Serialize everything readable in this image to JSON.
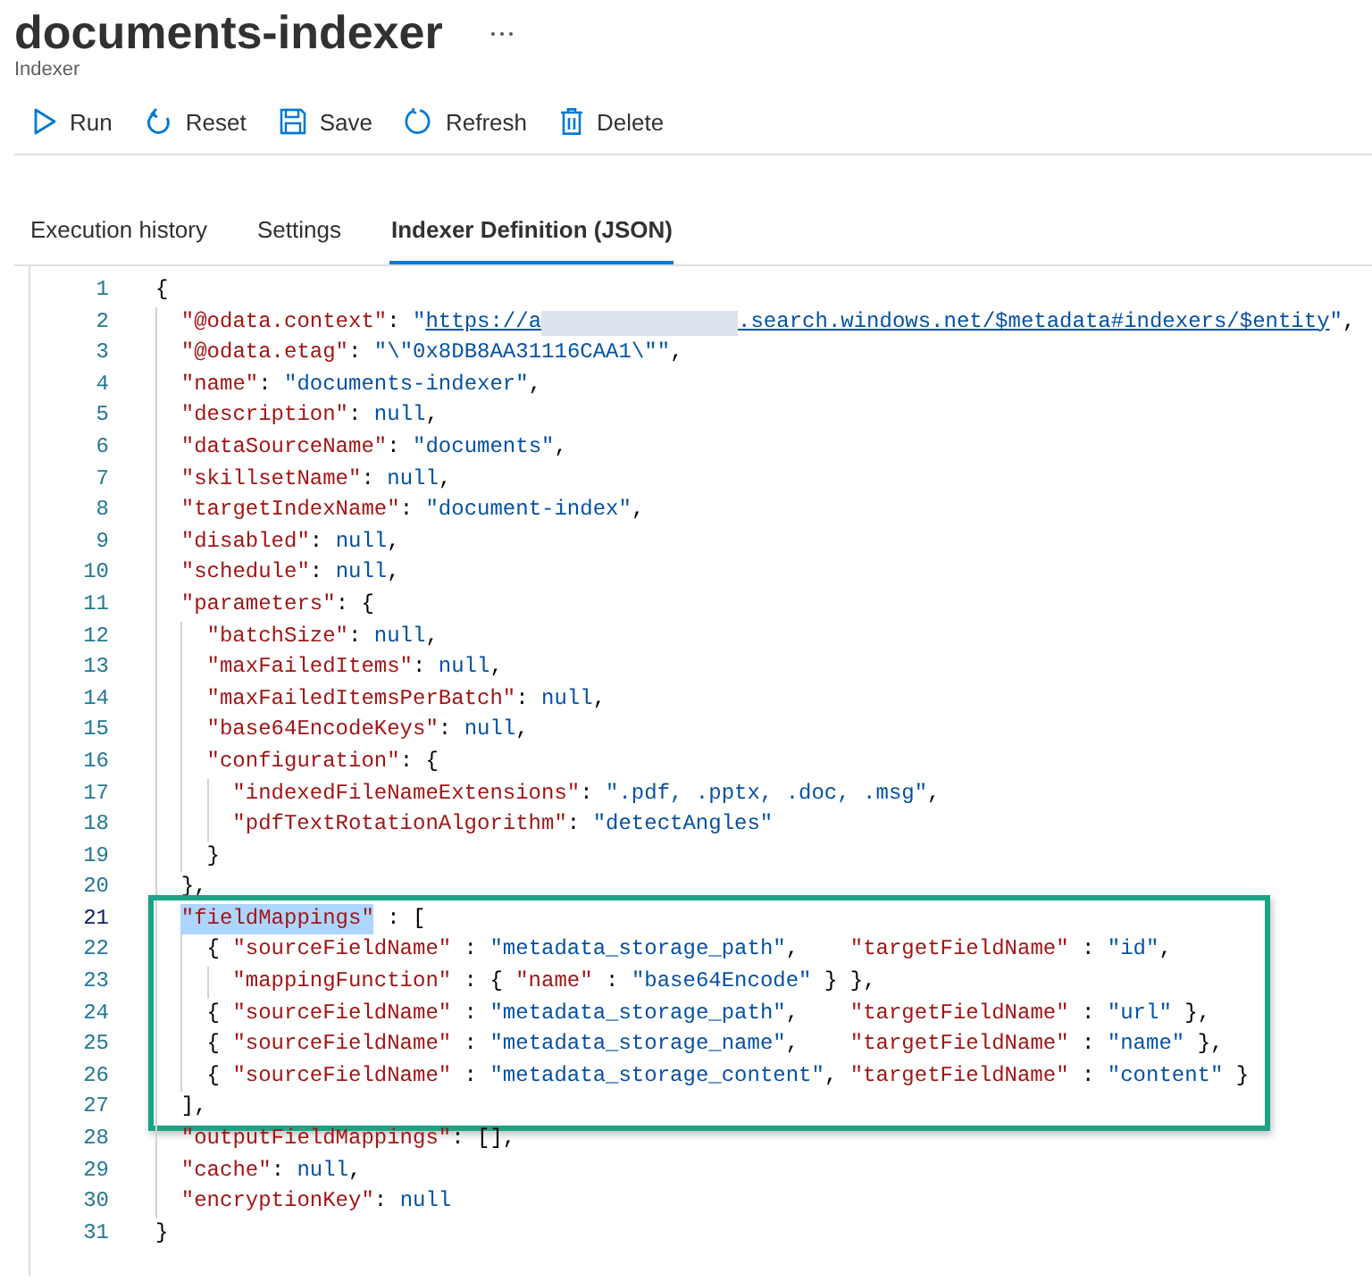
{
  "header": {
    "title": "documents-indexer",
    "subtitle": "Indexer"
  },
  "toolbar": [
    {
      "kind": "run",
      "label": "Run"
    },
    {
      "kind": "reset",
      "label": "Reset"
    },
    {
      "kind": "save",
      "label": "Save"
    },
    {
      "kind": "refresh",
      "label": "Refresh"
    },
    {
      "kind": "delete",
      "label": "Delete"
    }
  ],
  "tabs": [
    {
      "label": "Execution history",
      "selected": false
    },
    {
      "label": "Settings",
      "selected": false
    },
    {
      "label": "Indexer Definition (JSON)",
      "selected": true
    }
  ],
  "editor": {
    "lines": [
      {
        "number": "1",
        "current": false,
        "boxed": false,
        "tokens": [
          {
            "kind": "p",
            "text": "{"
          }
        ],
        "children": [
          {
            "number": "2",
            "current": false,
            "boxed": false,
            "tokens": [
              {
                "kind": "k",
                "text": "\"@odata.context\""
              },
              {
                "kind": "p",
                "text": ": "
              },
              {
                "kind": "s",
                "text": "\""
              },
              {
                "kind": "link",
                "text": "https://a"
              },
              {
                "kind": "redacted"
              },
              {
                "kind": "link",
                "text": ".search.windows.net/$metadata#indexers/$entity"
              },
              {
                "kind": "s",
                "text": "\""
              },
              {
                "kind": "p",
                "text": ","
              }
            ]
          },
          {
            "number": "3",
            "current": false,
            "boxed": false,
            "tokens": [
              {
                "kind": "k",
                "text": "\"@odata.etag\""
              },
              {
                "kind": "p",
                "text": ": "
              },
              {
                "kind": "s",
                "text": "\"\\\"0x8DB8AA31116CAA1\\\"\""
              },
              {
                "kind": "p",
                "text": ","
              }
            ]
          },
          {
            "number": "4",
            "current": false,
            "boxed": false,
            "tokens": [
              {
                "kind": "k",
                "text": "\"name\""
              },
              {
                "kind": "p",
                "text": ": "
              },
              {
                "kind": "s",
                "text": "\"documents-indexer\""
              },
              {
                "kind": "p",
                "text": ","
              }
            ]
          },
          {
            "number": "5",
            "current": false,
            "boxed": false,
            "tokens": [
              {
                "kind": "k",
                "text": "\"description\""
              },
              {
                "kind": "p",
                "text": ": "
              },
              {
                "kind": "n",
                "text": "null"
              },
              {
                "kind": "p",
                "text": ","
              }
            ]
          },
          {
            "number": "6",
            "current": false,
            "boxed": false,
            "tokens": [
              {
                "kind": "k",
                "text": "\"dataSourceName\""
              },
              {
                "kind": "p",
                "text": ": "
              },
              {
                "kind": "s",
                "text": "\"documents\""
              },
              {
                "kind": "p",
                "text": ","
              }
            ]
          },
          {
            "number": "7",
            "current": false,
            "boxed": false,
            "tokens": [
              {
                "kind": "k",
                "text": "\"skillsetName\""
              },
              {
                "kind": "p",
                "text": ": "
              },
              {
                "kind": "n",
                "text": "null"
              },
              {
                "kind": "p",
                "text": ","
              }
            ]
          },
          {
            "number": "8",
            "current": false,
            "boxed": false,
            "tokens": [
              {
                "kind": "k",
                "text": "\"targetIndexName\""
              },
              {
                "kind": "p",
                "text": ": "
              },
              {
                "kind": "s",
                "text": "\"document-index\""
              },
              {
                "kind": "p",
                "text": ","
              }
            ]
          },
          {
            "number": "9",
            "current": false,
            "boxed": false,
            "tokens": [
              {
                "kind": "k",
                "text": "\"disabled\""
              },
              {
                "kind": "p",
                "text": ": "
              },
              {
                "kind": "n",
                "text": "null"
              },
              {
                "kind": "p",
                "text": ","
              }
            ]
          },
          {
            "number": "10",
            "current": false,
            "boxed": false,
            "tokens": [
              {
                "kind": "k",
                "text": "\"schedule\""
              },
              {
                "kind": "p",
                "text": ": "
              },
              {
                "kind": "n",
                "text": "null"
              },
              {
                "kind": "p",
                "text": ","
              }
            ]
          },
          {
            "number": "11",
            "current": false,
            "boxed": false,
            "tokens": [
              {
                "kind": "k",
                "text": "\"parameters\""
              },
              {
                "kind": "p",
                "text": ": {"
              }
            ],
            "children": [
              {
                "number": "12",
                "current": false,
                "boxed": false,
                "tokens": [
                  {
                    "kind": "k",
                    "text": "\"batchSize\""
                  },
                  {
                    "kind": "p",
                    "text": ": "
                  },
                  {
                    "kind": "n",
                    "text": "null"
                  },
                  {
                    "kind": "p",
                    "text": ","
                  }
                ]
              },
              {
                "number": "13",
                "current": false,
                "boxed": false,
                "tokens": [
                  {
                    "kind": "k",
                    "text": "\"maxFailedItems\""
                  },
                  {
                    "kind": "p",
                    "text": ": "
                  },
                  {
                    "kind": "n",
                    "text": "null"
                  },
                  {
                    "kind": "p",
                    "text": ","
                  }
                ]
              },
              {
                "number": "14",
                "current": false,
                "boxed": false,
                "tokens": [
                  {
                    "kind": "k",
                    "text": "\"maxFailedItemsPerBatch\""
                  },
                  {
                    "kind": "p",
                    "text": ": "
                  },
                  {
                    "kind": "n",
                    "text": "null"
                  },
                  {
                    "kind": "p",
                    "text": ","
                  }
                ]
              },
              {
                "number": "15",
                "current": false,
                "boxed": false,
                "tokens": [
                  {
                    "kind": "k",
                    "text": "\"base64EncodeKeys\""
                  },
                  {
                    "kind": "p",
                    "text": ": "
                  },
                  {
                    "kind": "n",
                    "text": "null"
                  },
                  {
                    "kind": "p",
                    "text": ","
                  }
                ]
              },
              {
                "number": "16",
                "current": false,
                "boxed": false,
                "tokens": [
                  {
                    "kind": "k",
                    "text": "\"configuration\""
                  },
                  {
                    "kind": "p",
                    "text": ": {"
                  }
                ],
                "children": [
                  {
                    "number": "17",
                    "current": false,
                    "boxed": false,
                    "tokens": [
                      {
                        "kind": "k",
                        "text": "\"indexedFileNameExtensions\""
                      },
                      {
                        "kind": "p",
                        "text": ": "
                      },
                      {
                        "kind": "s",
                        "text": "\".pdf, .pptx, .doc, .msg\""
                      },
                      {
                        "kind": "p",
                        "text": ","
                      }
                    ]
                  },
                  {
                    "number": "18",
                    "current": false,
                    "boxed": false,
                    "tokens": [
                      {
                        "kind": "k",
                        "text": "\"pdfTextRotationAlgorithm\""
                      },
                      {
                        "kind": "p",
                        "text": ": "
                      },
                      {
                        "kind": "s",
                        "text": "\"detectAngles\""
                      }
                    ]
                  }
                ],
                "end": {
                  "number": "19",
                  "current": false,
                  "tokens": [
                    {
                      "kind": "p",
                      "text": "}"
                    }
                  ]
                }
              }
            ],
            "end": {
              "number": "20",
              "current": false,
              "tokens": [
                {
                  "kind": "p",
                  "text": "},"
                }
              ]
            }
          },
          {
            "number": "21",
            "current": true,
            "boxed": true,
            "tokens": [
              {
                "kind": "selkey",
                "text": "\"fieldMappings\""
              },
              {
                "kind": "p",
                "text": " : ["
              }
            ],
            "children": [
              {
                "number": "22",
                "current": false,
                "boxed": false,
                "tokens": [
                  {
                    "kind": "p",
                    "text": "{ "
                  },
                  {
                    "kind": "k",
                    "text": "\"sourceFieldName\""
                  },
                  {
                    "kind": "p",
                    "text": " : "
                  },
                  {
                    "kind": "s",
                    "text": "\"metadata_storage_path\""
                  },
                  {
                    "kind": "p",
                    "text": ",    "
                  },
                  {
                    "kind": "k",
                    "text": "\"targetFieldName\""
                  },
                  {
                    "kind": "p",
                    "text": " : "
                  },
                  {
                    "kind": "s",
                    "text": "\"id\""
                  },
                  {
                    "kind": "p",
                    "text": ","
                  }
                ],
                "children": [
                  {
                    "number": "23",
                    "current": false,
                    "boxed": false,
                    "tokens": [
                      {
                        "kind": "k",
                        "text": "\"mappingFunction\""
                      },
                      {
                        "kind": "p",
                        "text": " : { "
                      },
                      {
                        "kind": "k",
                        "text": "\"name\""
                      },
                      {
                        "kind": "p",
                        "text": " : "
                      },
                      {
                        "kind": "s",
                        "text": "\"base64Encode\""
                      },
                      {
                        "kind": "p",
                        "text": " } },"
                      }
                    ]
                  }
                ]
              },
              {
                "number": "24",
                "current": false,
                "boxed": false,
                "tokens": [
                  {
                    "kind": "p",
                    "text": "{ "
                  },
                  {
                    "kind": "k",
                    "text": "\"sourceFieldName\""
                  },
                  {
                    "kind": "p",
                    "text": " : "
                  },
                  {
                    "kind": "s",
                    "text": "\"metadata_storage_path\""
                  },
                  {
                    "kind": "p",
                    "text": ",    "
                  },
                  {
                    "kind": "k",
                    "text": "\"targetFieldName\""
                  },
                  {
                    "kind": "p",
                    "text": " : "
                  },
                  {
                    "kind": "s",
                    "text": "\"url\""
                  },
                  {
                    "kind": "p",
                    "text": " },"
                  }
                ]
              },
              {
                "number": "25",
                "current": false,
                "boxed": false,
                "tokens": [
                  {
                    "kind": "p",
                    "text": "{ "
                  },
                  {
                    "kind": "k",
                    "text": "\"sourceFieldName\""
                  },
                  {
                    "kind": "p",
                    "text": " : "
                  },
                  {
                    "kind": "s",
                    "text": "\"metadata_storage_name\""
                  },
                  {
                    "kind": "p",
                    "text": ",    "
                  },
                  {
                    "kind": "k",
                    "text": "\"targetFieldName\""
                  },
                  {
                    "kind": "p",
                    "text": " : "
                  },
                  {
                    "kind": "s",
                    "text": "\"name\""
                  },
                  {
                    "kind": "p",
                    "text": " },"
                  }
                ]
              },
              {
                "number": "26",
                "current": false,
                "boxed": false,
                "tokens": [
                  {
                    "kind": "p",
                    "text": "{ "
                  },
                  {
                    "kind": "k",
                    "text": "\"sourceFieldName\""
                  },
                  {
                    "kind": "p",
                    "text": " : "
                  },
                  {
                    "kind": "s",
                    "text": "\"metadata_storage_content\""
                  },
                  {
                    "kind": "p",
                    "text": ", "
                  },
                  {
                    "kind": "k",
                    "text": "\"targetFieldName\""
                  },
                  {
                    "kind": "p",
                    "text": " : "
                  },
                  {
                    "kind": "s",
                    "text": "\"content\""
                  },
                  {
                    "kind": "p",
                    "text": " }"
                  }
                ]
              }
            ],
            "end": {
              "number": "27",
              "current": false,
              "tokens": [
                {
                  "kind": "p",
                  "text": "],"
                }
              ]
            }
          },
          {
            "number": "28",
            "current": false,
            "boxed": false,
            "tokens": [
              {
                "kind": "k",
                "text": "\"outputFieldMappings\""
              },
              {
                "kind": "p",
                "text": ": [],"
              }
            ]
          },
          {
            "number": "29",
            "current": false,
            "boxed": false,
            "tokens": [
              {
                "kind": "k",
                "text": "\"cache\""
              },
              {
                "kind": "p",
                "text": ": "
              },
              {
                "kind": "n",
                "text": "null"
              },
              {
                "kind": "p",
                "text": ","
              }
            ]
          },
          {
            "number": "30",
            "current": false,
            "boxed": false,
            "tokens": [
              {
                "kind": "k",
                "text": "\"encryptionKey\""
              },
              {
                "kind": "p",
                "text": ": "
              },
              {
                "kind": "n",
                "text": "null"
              }
            ]
          }
        ],
        "end": {
          "number": "31",
          "current": false,
          "tokens": [
            {
              "kind": "p",
              "text": "}"
            }
          ]
        }
      }
    ]
  }
}
